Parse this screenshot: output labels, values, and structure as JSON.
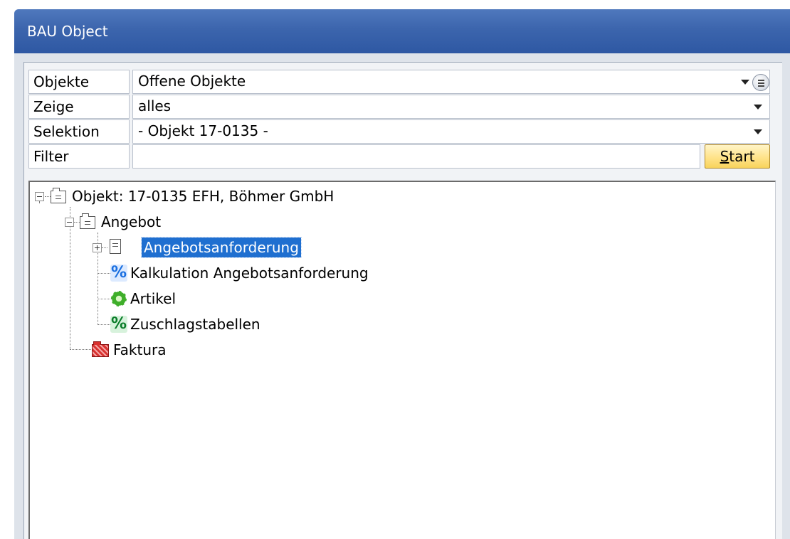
{
  "window": {
    "title": "BAU Object"
  },
  "filters": {
    "objekte": {
      "label": "Objekte",
      "value": "Offene Objekte"
    },
    "zeige": {
      "label": "Zeige",
      "value": "alles"
    },
    "selektion": {
      "label": "Selektion",
      "value": "- Objekt 17-0135 -"
    },
    "filter": {
      "label": "Filter",
      "value": "",
      "start_label_first": "S",
      "start_label_rest": "tart"
    }
  },
  "tree": {
    "root": {
      "label": "Objekt: 17-0135 EFH, Böhmer GmbH",
      "icon": "folder-icon",
      "expanded": true
    },
    "angebot": {
      "label": "Angebot",
      "icon": "folder-icon",
      "expanded": true
    },
    "angebotsanforderung": {
      "label": "Angebotsanforderung",
      "icon": "document-icon",
      "expanded": false,
      "selected": true
    },
    "kalkulation": {
      "label": "Kalkulation Angebotsanforderung",
      "icon": "percent-icon"
    },
    "artikel": {
      "label": "Artikel",
      "icon": "gear-icon"
    },
    "zuschlagstabellen": {
      "label": "Zuschlagstabellen",
      "icon": "percent-icon"
    },
    "faktura": {
      "label": "Faktura",
      "icon": "red-folder-icon"
    }
  },
  "colors": {
    "titlebar": "#3c65ad",
    "selection": "#1f6fd0",
    "start_button": "#ffe38a"
  }
}
